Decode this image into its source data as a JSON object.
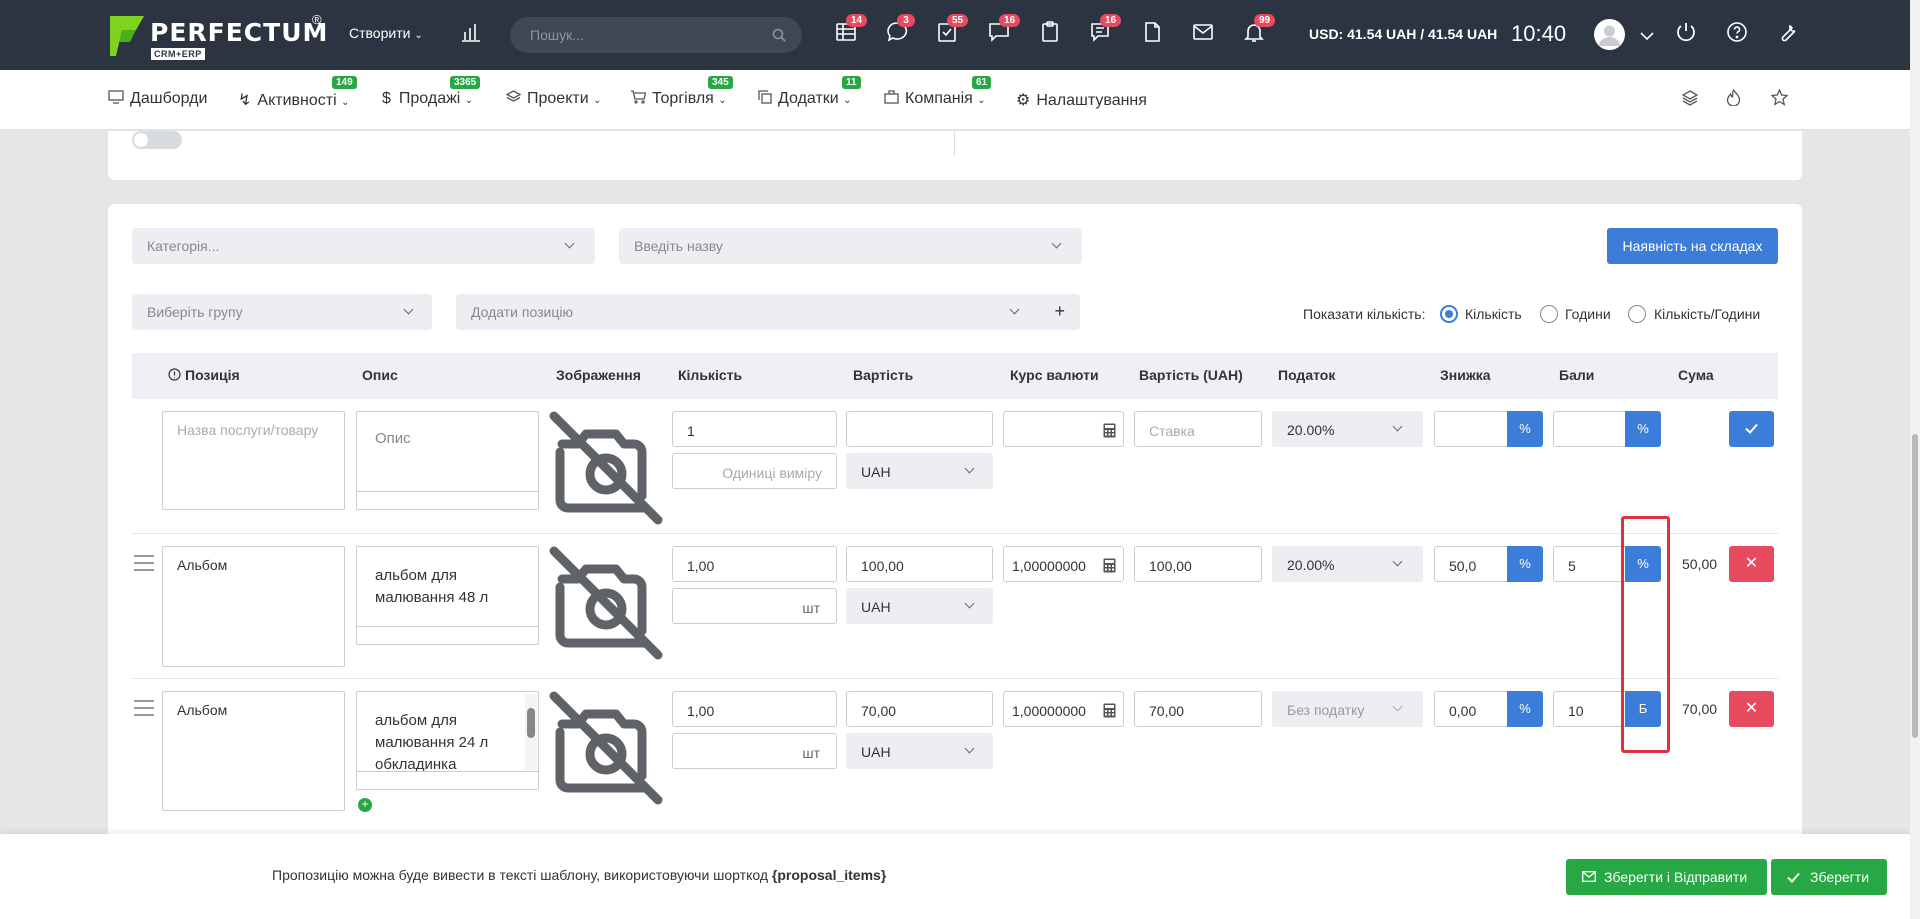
{
  "topbar": {
    "logo_text": "PERFECTUM",
    "logo_reg": "®",
    "logo_sub": "CRM+ERP",
    "create_label": "Створити",
    "search_placeholder": "Пошук...",
    "badges": {
      "table": "14",
      "chat": "3",
      "tasks": "55",
      "comments": "16",
      "notes": "16",
      "bell": "99"
    },
    "currency": "USD: 41.54 UAH / 41.54 UAH",
    "time": "10:40"
  },
  "nav": {
    "items": [
      {
        "label": "Дашборди",
        "badge": ""
      },
      {
        "label": "Активності",
        "badge": "149"
      },
      {
        "label": "Продажі",
        "badge": "3365"
      },
      {
        "label": "Проекти",
        "badge": ""
      },
      {
        "label": "Торгівля",
        "badge": "345"
      },
      {
        "label": "Додатки",
        "badge": "11"
      },
      {
        "label": "Компанія",
        "badge": "61"
      },
      {
        "label": "Налаштування",
        "badge": ""
      }
    ]
  },
  "filters": {
    "category_placeholder": "Категорія...",
    "name_placeholder": "Введіть назву",
    "stock_button": "Наявність на складах",
    "group_placeholder": "Виберіть групу",
    "add_position_placeholder": "Додати позицію",
    "add_plus": "+",
    "show_qty_label": "Показати кількість:",
    "qty_options": [
      "Кількість",
      "Години",
      "Кількість/Години"
    ],
    "qty_selected": "Кількість"
  },
  "table": {
    "headers": [
      "Позиція",
      "Опис",
      "Зображення",
      "Кількість",
      "Вартість",
      "Курс валюти",
      "Вартість (UAH)",
      "Податок",
      "Знижка",
      "Бали",
      "Сума"
    ],
    "new_row": {
      "name_placeholder": "Назва послуги/товару",
      "desc_placeholder": "Опис",
      "qty": "1",
      "unit_placeholder": "Одиниці виміру",
      "currency": "UAH",
      "rate_placeholder": "Ставка",
      "tax": "20.00%",
      "discount_btn": "%",
      "points_btn": "%"
    },
    "rows": [
      {
        "name": "Альбом",
        "desc": "альбом для малювання 48 л",
        "qty": "1,00",
        "unit": "шт",
        "price": "100,00",
        "currency": "UAH",
        "rate": "1,00000000",
        "price_uah": "100,00",
        "tax": "20.00%",
        "discount": "50,0",
        "discount_btn": "%",
        "points": "5",
        "points_btn": "%",
        "sum": "50,00"
      },
      {
        "name": "Альбом",
        "desc": "альбом для малювання 24 л обкладинка",
        "qty": "1,00",
        "unit": "шт",
        "price": "70,00",
        "currency": "UAH",
        "rate": "1,00000000",
        "price_uah": "70,00",
        "tax": "Без податку",
        "discount": "0,00",
        "discount_btn": "%",
        "points": "10",
        "points_btn": "Б",
        "sum": "70,00"
      }
    ]
  },
  "footer": {
    "hint_text": "Пропозицію можна буде вивести в тексті шаблону, використовуючи шорткод",
    "hint_code": "{proposal_items}",
    "save_send": "Зберегти і Відправити",
    "save": "Зберегти"
  }
}
